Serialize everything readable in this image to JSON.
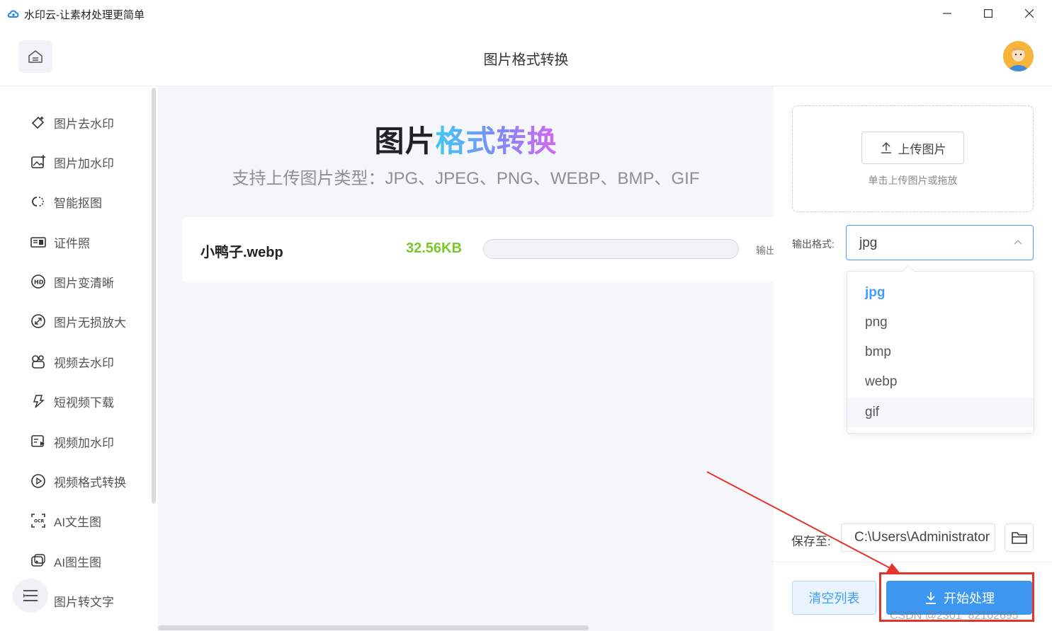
{
  "window": {
    "title": "水印云-让素材处理更简单"
  },
  "header": {
    "title": "图片格式转换"
  },
  "sidebar": {
    "items": [
      {
        "label": "图片去水印",
        "icon": "eraser-icon"
      },
      {
        "label": "图片加水印",
        "icon": "image-add-icon"
      },
      {
        "label": "智能抠图",
        "icon": "cutout-icon"
      },
      {
        "label": "证件照",
        "icon": "id-card-icon"
      },
      {
        "label": "图片变清晰",
        "icon": "hd-icon"
      },
      {
        "label": "图片无损放大",
        "icon": "enlarge-icon"
      },
      {
        "label": "视频去水印",
        "icon": "video-eraser-icon"
      },
      {
        "label": "短视频下载",
        "icon": "short-video-icon"
      },
      {
        "label": "视频加水印",
        "icon": "video-add-icon"
      },
      {
        "label": "视频格式转换",
        "icon": "play-circle-icon"
      },
      {
        "label": "AI文生图",
        "icon": "ocr-icon"
      },
      {
        "label": "AI图生图",
        "icon": "ai-image-icon"
      },
      {
        "label": "图片转文字",
        "icon": "text-icon"
      }
    ]
  },
  "main": {
    "hero_title_a": "图片",
    "hero_title_b": "格式转换",
    "hero_subtitle": "支持上传图片类型：JPG、JPEG、PNG、WEBP、BMP、GIF",
    "file": {
      "name": "小鸭子.webp",
      "size": "32.56KB",
      "progress": 0,
      "output_label": "输出"
    }
  },
  "panel": {
    "upload_button": "上传图片",
    "upload_hint": "单击上传图片或拖放",
    "format_label": "输出格式:",
    "format_value": "jpg",
    "format_options": [
      "jpg",
      "png",
      "bmp",
      "webp",
      "gif"
    ],
    "save_label": "保存至:",
    "save_path": "C:\\Users\\Administrator",
    "clear_button": "清空列表",
    "start_button": "开始处理"
  },
  "watermark": "CSDN @2301_82102695",
  "colors": {
    "accent": "#409eff",
    "size_green": "#7ac72c",
    "annotation_red": "#e5332a"
  }
}
